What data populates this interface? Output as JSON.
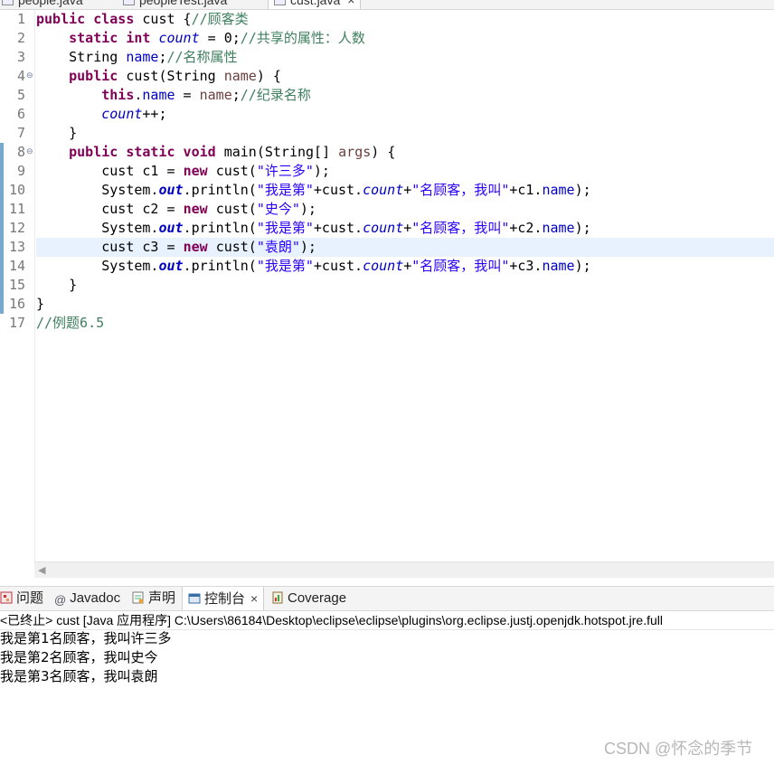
{
  "editor_tabs": [
    {
      "label": "people.java"
    },
    {
      "label": "peopleTest.java"
    },
    {
      "label": "cust.java"
    }
  ],
  "code_lines": [
    {
      "num": "1",
      "fold": "",
      "segs": [
        [
          "kw",
          "public class "
        ],
        [
          "txt",
          "cust {"
        ],
        [
          "cm",
          "//顾客类"
        ]
      ]
    },
    {
      "num": "2",
      "fold": "",
      "segs": [
        [
          "txt",
          "    "
        ],
        [
          "kw",
          "static int "
        ],
        [
          "sf",
          "count"
        ],
        [
          "txt",
          " = 0;"
        ],
        [
          "cm",
          "//共享的属性：人数"
        ]
      ]
    },
    {
      "num": "3",
      "fold": "",
      "segs": [
        [
          "txt",
          "    String "
        ],
        [
          "fld",
          "name"
        ],
        [
          "txt",
          ";"
        ],
        [
          "cm",
          "//名称属性"
        ]
      ]
    },
    {
      "num": "4",
      "fold": "⊖",
      "segs": [
        [
          "txt",
          "    "
        ],
        [
          "kw",
          "public "
        ],
        [
          "txt",
          "cust(String "
        ],
        [
          "par",
          "name"
        ],
        [
          "txt",
          ") {"
        ]
      ]
    },
    {
      "num": "5",
      "fold": "",
      "segs": [
        [
          "txt",
          "        "
        ],
        [
          "kw",
          "this"
        ],
        [
          "txt",
          "."
        ],
        [
          "fld",
          "name"
        ],
        [
          "txt",
          " = "
        ],
        [
          "par",
          "name"
        ],
        [
          "txt",
          ";"
        ],
        [
          "cm",
          "//纪录名称"
        ]
      ]
    },
    {
      "num": "6",
      "fold": "",
      "segs": [
        [
          "txt",
          "        "
        ],
        [
          "sf",
          "count"
        ],
        [
          "txt",
          "++;"
        ]
      ]
    },
    {
      "num": "7",
      "fold": "",
      "segs": [
        [
          "txt",
          "    }"
        ]
      ]
    },
    {
      "num": "8",
      "fold": "⊖",
      "segs": [
        [
          "txt",
          "    "
        ],
        [
          "kw",
          "public static void "
        ],
        [
          "txt",
          "main(String[] "
        ],
        [
          "par",
          "args"
        ],
        [
          "txt",
          ") {"
        ]
      ]
    },
    {
      "num": "9",
      "fold": "",
      "segs": [
        [
          "txt",
          "        cust c1 = "
        ],
        [
          "kw",
          "new "
        ],
        [
          "txt",
          "cust("
        ],
        [
          "str",
          "\"许三多\""
        ],
        [
          "txt",
          ");"
        ]
      ]
    },
    {
      "num": "10",
      "fold": "",
      "segs": [
        [
          "txt",
          "        System."
        ],
        [
          "sfb",
          "out"
        ],
        [
          "txt",
          ".println("
        ],
        [
          "str",
          "\"我是第\""
        ],
        [
          "txt",
          "+cust."
        ],
        [
          "sf",
          "count"
        ],
        [
          "txt",
          "+"
        ],
        [
          "str",
          "\"名顾客，我叫\""
        ],
        [
          "txt",
          "+c1."
        ],
        [
          "fld",
          "name"
        ],
        [
          "txt",
          ");"
        ]
      ]
    },
    {
      "num": "11",
      "fold": "",
      "segs": [
        [
          "txt",
          "        cust c2 = "
        ],
        [
          "kw",
          "new "
        ],
        [
          "txt",
          "cust("
        ],
        [
          "str",
          "\"史今\""
        ],
        [
          "txt",
          ");"
        ]
      ]
    },
    {
      "num": "12",
      "fold": "",
      "segs": [
        [
          "txt",
          "        System."
        ],
        [
          "sfb",
          "out"
        ],
        [
          "txt",
          ".println("
        ],
        [
          "str",
          "\"我是第\""
        ],
        [
          "txt",
          "+cust."
        ],
        [
          "sf",
          "count"
        ],
        [
          "txt",
          "+"
        ],
        [
          "str",
          "\"名顾客，我叫\""
        ],
        [
          "txt",
          "+c2."
        ],
        [
          "fld",
          "name"
        ],
        [
          "txt",
          ");"
        ]
      ]
    },
    {
      "num": "13",
      "fold": "",
      "segs": [
        [
          "txt",
          "        cust c3 = "
        ],
        [
          "kw",
          "new "
        ],
        [
          "txt",
          "cust("
        ],
        [
          "str",
          "\"袁朗\""
        ],
        [
          "txt",
          ");"
        ]
      ]
    },
    {
      "num": "14",
      "fold": "",
      "segs": [
        [
          "txt",
          "        System."
        ],
        [
          "sfb",
          "out"
        ],
        [
          "txt",
          ".println("
        ],
        [
          "str",
          "\"我是第\""
        ],
        [
          "txt",
          "+cust."
        ],
        [
          "sf",
          "count"
        ],
        [
          "txt",
          "+"
        ],
        [
          "str",
          "\"名顾客，我叫\""
        ],
        [
          "txt",
          "+c3."
        ],
        [
          "fld",
          "name"
        ],
        [
          "txt",
          ");"
        ]
      ]
    },
    {
      "num": "15",
      "fold": "",
      "segs": [
        [
          "txt",
          "    }"
        ]
      ]
    },
    {
      "num": "16",
      "fold": "",
      "segs": [
        [
          "txt",
          "}"
        ]
      ]
    },
    {
      "num": "17",
      "fold": "",
      "segs": [
        [
          "cm",
          "//例题6.5"
        ]
      ]
    }
  ],
  "current_line": "13",
  "view_tabs": {
    "problems": "问题",
    "javadoc": "Javadoc",
    "declaration": "声明",
    "console": "控制台",
    "console_close": "×",
    "coverage": "Coverage"
  },
  "console": {
    "header": "<已终止> cust [Java 应用程序] C:\\Users\\86184\\Desktop\\eclipse\\eclipse\\plugins\\org.eclipse.justj.openjdk.hotspot.jre.full",
    "output": [
      "我是第1名顾客，我叫许三多",
      "我是第2名顾客，我叫史今",
      "我是第3名顾客，我叫袁朗"
    ]
  },
  "watermark": "CSDN @怀念的季节",
  "colors": {
    "keyword": "#7f0055",
    "comment": "#3f7f5f",
    "field": "#0000c0",
    "string": "#2a00ff",
    "current_line": "#e8f2fe"
  }
}
